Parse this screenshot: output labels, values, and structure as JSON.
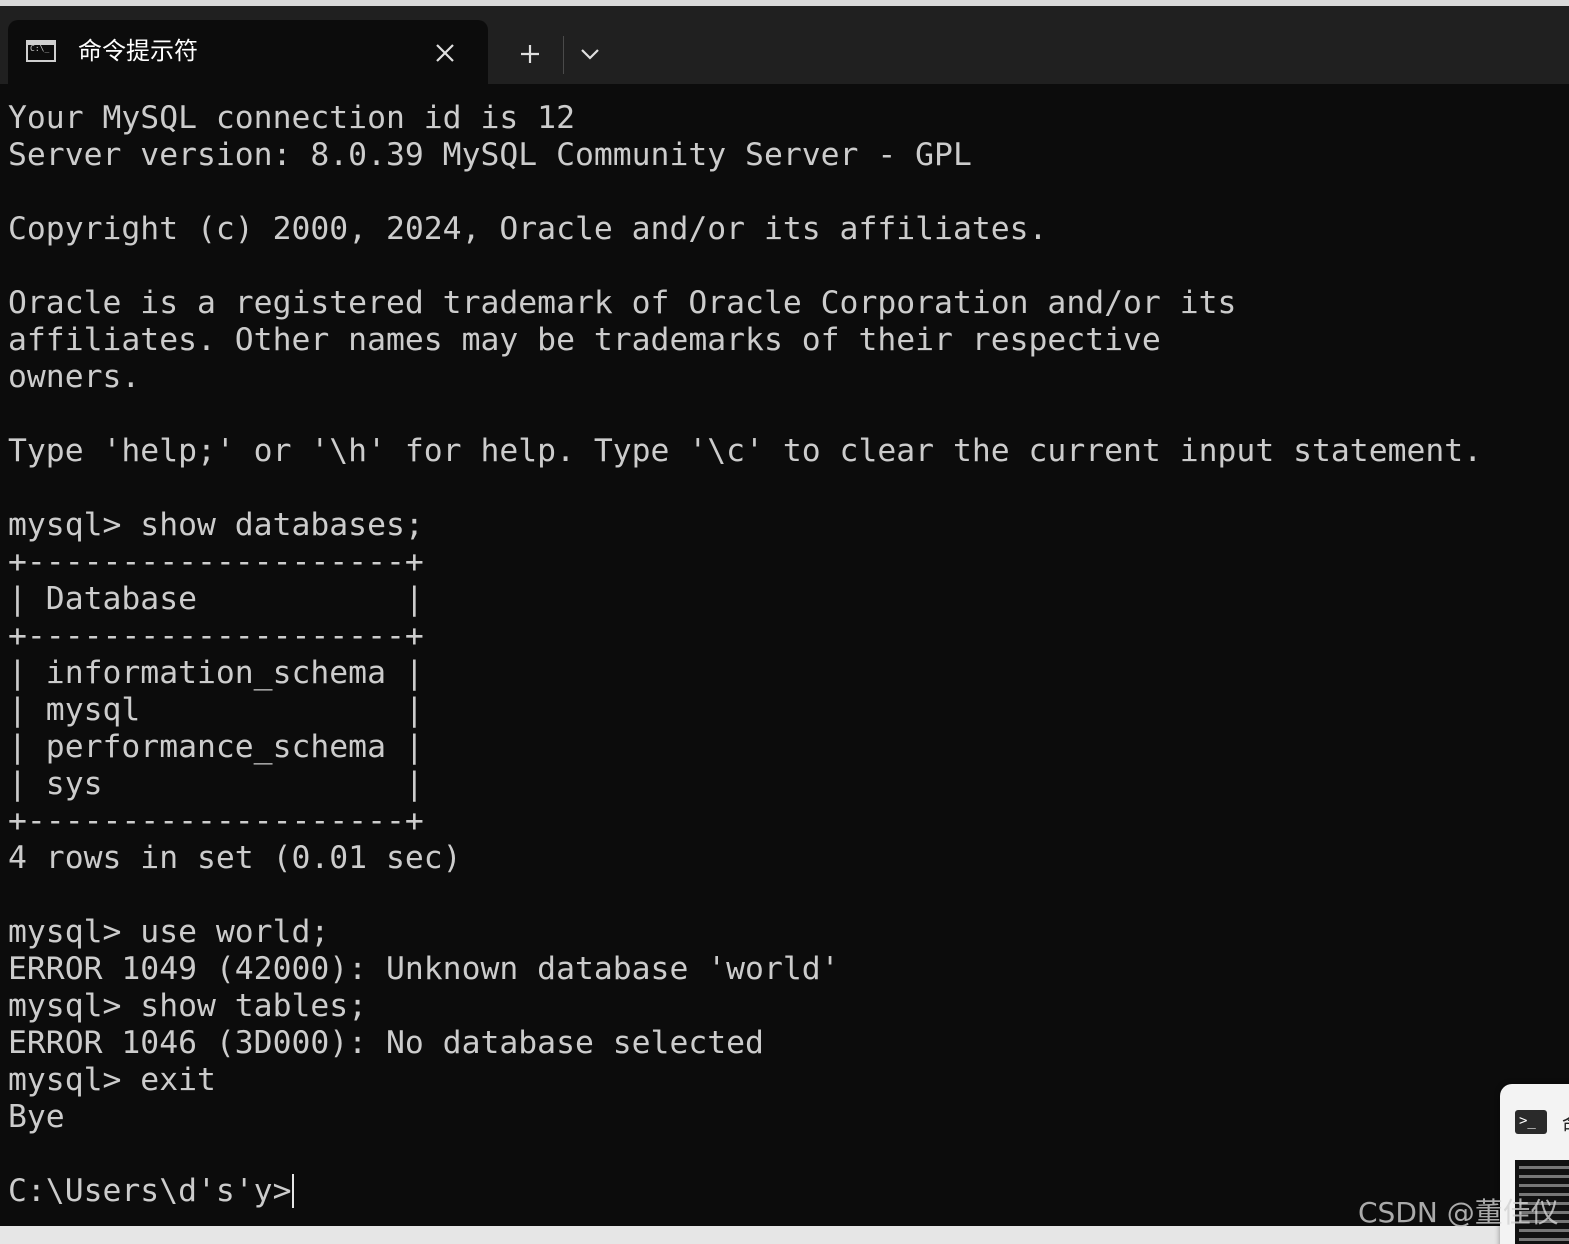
{
  "window": {
    "tab_title": "命令提示符",
    "tab_icon": "cmd-icon",
    "close_icon": "close-icon",
    "new_tab_icon": "plus-icon",
    "dropdown_icon": "chevron-down-icon"
  },
  "terminal": {
    "lines": [
      "Your MySQL connection id is 12",
      "Server version: 8.0.39 MySQL Community Server - GPL",
      "",
      "Copyright (c) 2000, 2024, Oracle and/or its affiliates.",
      "",
      "Oracle is a registered trademark of Oracle Corporation and/or its",
      "affiliates. Other names may be trademarks of their respective",
      "owners.",
      "",
      "Type 'help;' or '\\h' for help. Type '\\c' to clear the current input statement.",
      "",
      "mysql> show databases;",
      "+--------------------+",
      "| Database           |",
      "+--------------------+",
      "| information_schema |",
      "| mysql              |",
      "| performance_schema |",
      "| sys                |",
      "+--------------------+",
      "4 rows in set (0.01 sec)",
      "",
      "mysql> use world;",
      "ERROR 1049 (42000): Unknown database 'world'",
      "mysql> show tables;",
      "ERROR 1046 (3D000): No database selected",
      "mysql> exit",
      "Bye",
      "",
      "C:\\Users\\d's'y>"
    ]
  },
  "taskbar_thumbnail": {
    "label": "命",
    "icon": "terminal-icon"
  },
  "watermark": "CSDN @董佳仪",
  "colors": {
    "terminal_bg": "#0c0c0c",
    "terminal_text": "#cccccc",
    "titlebar_bg": "#202020"
  }
}
